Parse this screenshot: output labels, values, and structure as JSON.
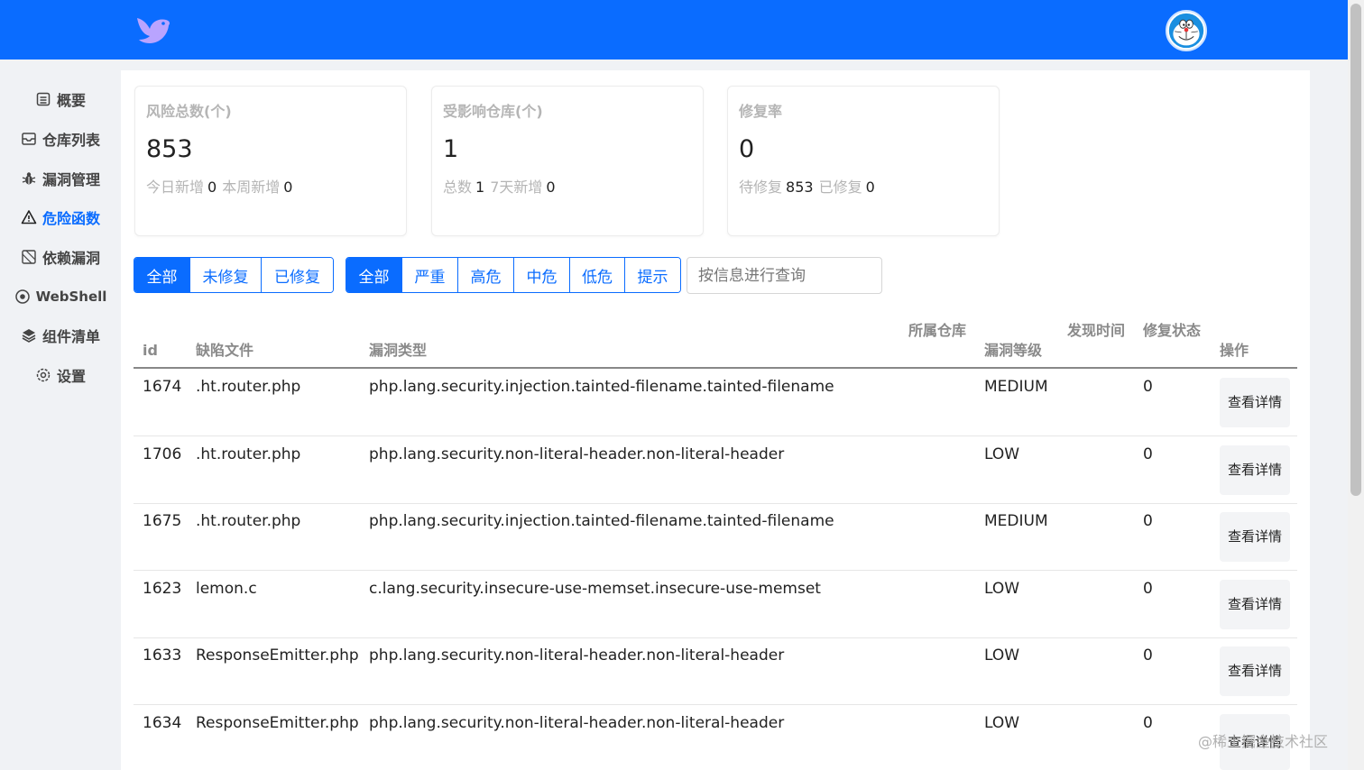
{
  "header": {
    "logo_icon": "bird-logo-icon",
    "avatar_icon": "doraemon-avatar",
    "brand_color": "#0a6cff"
  },
  "sidebar": {
    "items": [
      {
        "label": "概要",
        "icon": "document-list-icon",
        "active": false
      },
      {
        "label": "仓库列表",
        "icon": "inbox-icon",
        "active": false
      },
      {
        "label": "漏洞管理",
        "icon": "bug-icon",
        "active": false
      },
      {
        "label": "危险函数",
        "icon": "warning-triangle-icon",
        "active": true
      },
      {
        "label": "依赖漏洞",
        "icon": "dependency-icon",
        "active": false
      },
      {
        "label": "WebShell",
        "icon": "eye-icon",
        "active": false
      },
      {
        "label": "组件清单",
        "icon": "layers-icon",
        "active": false
      },
      {
        "label": "设置",
        "icon": "gear-icon",
        "active": false
      }
    ]
  },
  "stats": [
    {
      "title": "风险总数(个)",
      "value": "853",
      "sub1_label": "今日新增",
      "sub1_value": "0",
      "sub2_label": "本周新增",
      "sub2_value": "0"
    },
    {
      "title": "受影响仓库(个)",
      "value": "1",
      "sub1_label": "总数",
      "sub1_value": "1",
      "sub2_label": "7天新增",
      "sub2_value": "0"
    },
    {
      "title": "修复率",
      "value": "0",
      "sub1_label": "待修复",
      "sub1_value": "853",
      "sub2_label": "已修复",
      "sub2_value": "0"
    }
  ],
  "filters": {
    "status": [
      "全部",
      "未修复",
      "已修复"
    ],
    "status_selected": "全部",
    "severity": [
      "全部",
      "严重",
      "高危",
      "中危",
      "低危",
      "提示"
    ],
    "severity_selected": "全部",
    "search_placeholder": "按信息进行查询",
    "search_value": ""
  },
  "table": {
    "columns": [
      "id",
      "缺陷文件",
      "漏洞类型",
      "所属仓库",
      "漏洞等级",
      "发现时间",
      "修复状态",
      "操作"
    ],
    "detail_label": "查看详情",
    "rows": [
      {
        "id": "1674",
        "file": ".ht.router.php",
        "type": "php.lang.security.injection.tainted-filename.tainted-filename",
        "repo": "",
        "level": "MEDIUM",
        "time": "",
        "status": "0"
      },
      {
        "id": "1706",
        "file": ".ht.router.php",
        "type": "php.lang.security.non-literal-header.non-literal-header",
        "repo": "",
        "level": "LOW",
        "time": "",
        "status": "0"
      },
      {
        "id": "1675",
        "file": ".ht.router.php",
        "type": "php.lang.security.injection.tainted-filename.tainted-filename",
        "repo": "",
        "level": "MEDIUM",
        "time": "",
        "status": "0"
      },
      {
        "id": "1623",
        "file": "lemon.c",
        "type": "c.lang.security.insecure-use-memset.insecure-use-memset",
        "repo": "",
        "level": "LOW",
        "time": "",
        "status": "0"
      },
      {
        "id": "1633",
        "file": "ResponseEmitter.php",
        "type": "php.lang.security.non-literal-header.non-literal-header",
        "repo": "",
        "level": "LOW",
        "time": "",
        "status": "0"
      },
      {
        "id": "1634",
        "file": "ResponseEmitter.php",
        "type": "php.lang.security.non-literal-header.non-literal-header",
        "repo": "",
        "level": "LOW",
        "time": "",
        "status": "0"
      }
    ]
  },
  "watermark": "@稀土掘金技术社区"
}
